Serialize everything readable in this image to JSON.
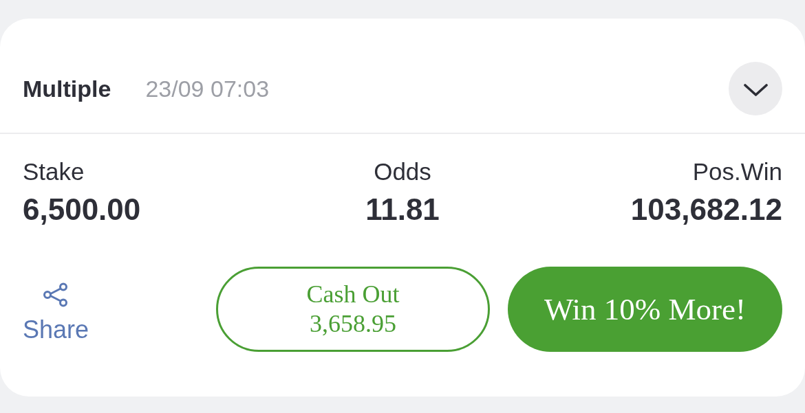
{
  "bet": {
    "type": "Multiple",
    "placed_at": "23/09 07:03",
    "expanded": false
  },
  "stats": [
    {
      "label": "Stake",
      "value": "6,500.00"
    },
    {
      "label": "Odds",
      "value": "11.81"
    },
    {
      "label": "Pos.Win",
      "value": "103,682.12"
    }
  ],
  "actions": {
    "share": {
      "label": "Share"
    },
    "cash_out": {
      "label": "Cash Out",
      "amount": "3,658.95"
    },
    "boost": {
      "label": "Win 10% More!"
    }
  }
}
